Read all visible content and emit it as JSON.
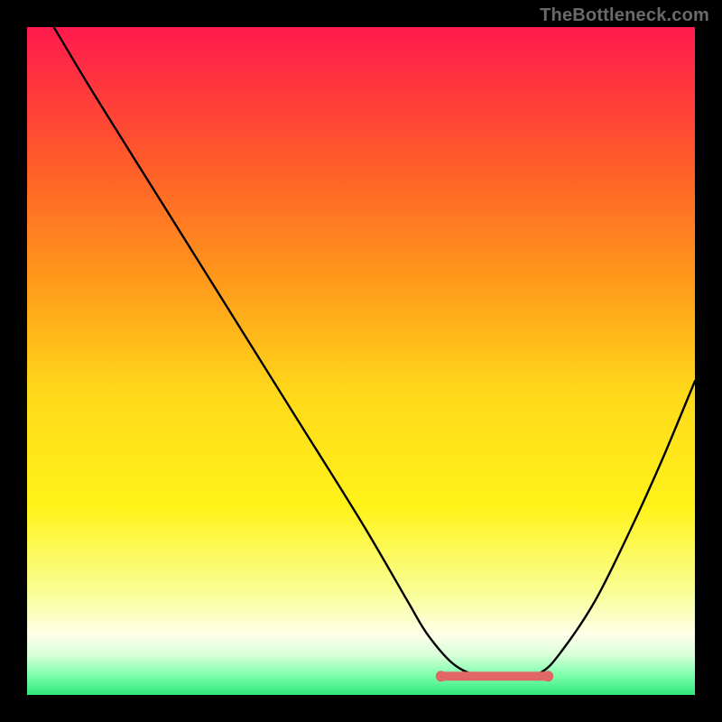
{
  "attribution": "TheBottleneck.com",
  "colors": {
    "top": "#ff1a4d",
    "mid_upper": "#ff8a1a",
    "mid": "#ffe81a",
    "mid_lower": "#f6ff7a",
    "whitish": "#fdffe8",
    "green_light": "#9fffb8",
    "green": "#2fe87a",
    "curve": "#000000",
    "flat_marker_fill": "#e16666",
    "flat_marker_stroke": "#c74848",
    "frame": "#000000"
  },
  "chart_data": {
    "type": "line",
    "title": "",
    "xlabel": "",
    "ylabel": "",
    "xlim": [
      0,
      100
    ],
    "ylim": [
      0,
      100
    ],
    "note": "Axes have no tick labels; values are plot-relative percentages estimated from the image. y=0 is the bottom edge, y=100 is the top edge.",
    "series": [
      {
        "name": "bottleneck-curve",
        "x": [
          4,
          10,
          20,
          30,
          40,
          50,
          57,
          60,
          64,
          68,
          73,
          77,
          80,
          85,
          90,
          95,
          100
        ],
        "y": [
          100,
          90,
          74,
          58,
          42,
          26,
          14,
          9,
          4.5,
          2.8,
          2.5,
          3.4,
          6.5,
          14,
          24,
          35,
          47
        ]
      }
    ],
    "flat_region": {
      "x_start": 62,
      "x_end": 78,
      "y": 2.8
    }
  }
}
